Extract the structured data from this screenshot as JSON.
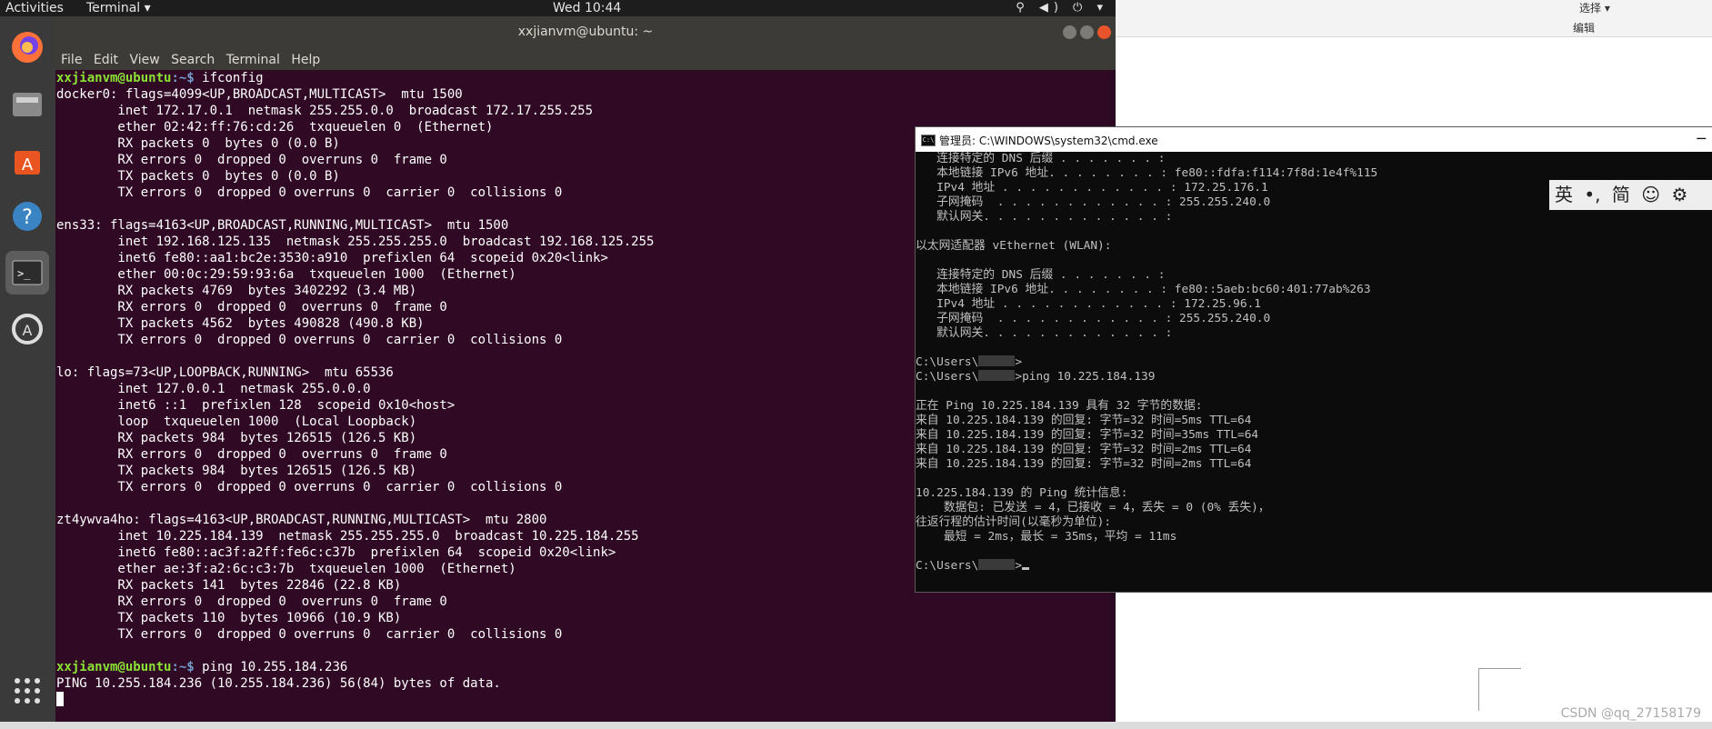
{
  "topbar": {
    "activities": "Activities",
    "app_menu": "Terminal ▾",
    "clock": "Wed 10:44",
    "tray": "⚲ ◀) ⏻ ▾"
  },
  "dock": {
    "items": [
      "firefox",
      "files",
      "software",
      "help",
      "terminal",
      "update"
    ],
    "grid": "⋮⋮⋮"
  },
  "terminal": {
    "title": "xxjianvm@ubuntu: ~",
    "menu": [
      "File",
      "Edit",
      "View",
      "Search",
      "Terminal",
      "Help"
    ],
    "prompt_user": "xxjianvm@ubuntu",
    "prompt_path": ":~$ ",
    "cmd1": "ifconfig",
    "output": "docker0: flags=4099<UP,BROADCAST,MULTICAST>  mtu 1500\n        inet 172.17.0.1  netmask 255.255.0.0  broadcast 172.17.255.255\n        ether 02:42:ff:76:cd:26  txqueuelen 0  (Ethernet)\n        RX packets 0  bytes 0 (0.0 B)\n        RX errors 0  dropped 0  overruns 0  frame 0\n        TX packets 0  bytes 0 (0.0 B)\n        TX errors 0  dropped 0 overruns 0  carrier 0  collisions 0\n\nens33: flags=4163<UP,BROADCAST,RUNNING,MULTICAST>  mtu 1500\n        inet 192.168.125.135  netmask 255.255.255.0  broadcast 192.168.125.255\n        inet6 fe80::aa1:bc2e:3530:a910  prefixlen 64  scopeid 0x20<link>\n        ether 00:0c:29:59:93:6a  txqueuelen 1000  (Ethernet)\n        RX packets 4769  bytes 3402292 (3.4 MB)\n        RX errors 0  dropped 0  overruns 0  frame 0\n        TX packets 4562  bytes 490828 (490.8 KB)\n        TX errors 0  dropped 0 overruns 0  carrier 0  collisions 0\n\nlo: flags=73<UP,LOOPBACK,RUNNING>  mtu 65536\n        inet 127.0.0.1  netmask 255.0.0.0\n        inet6 ::1  prefixlen 128  scopeid 0x10<host>\n        loop  txqueuelen 1000  (Local Loopback)\n        RX packets 984  bytes 126515 (126.5 KB)\n        RX errors 0  dropped 0  overruns 0  frame 0\n        TX packets 984  bytes 126515 (126.5 KB)\n        TX errors 0  dropped 0 overruns 0  carrier 0  collisions 0\n\nzt4ywva4ho: flags=4163<UP,BROADCAST,RUNNING,MULTICAST>  mtu 2800\n        inet 10.225.184.139  netmask 255.255.255.0  broadcast 10.225.184.255\n        inet6 fe80::ac3f:a2ff:fe6c:c37b  prefixlen 64  scopeid 0x20<link>\n        ether ae:3f:a2:6c:c3:7b  txqueuelen 1000  (Ethernet)\n        RX packets 141  bytes 22846 (22.8 KB)\n        RX errors 0  dropped 0  overruns 0  frame 0\n        TX packets 110  bytes 10966 (10.9 KB)\n        TX errors 0  dropped 0 overruns 0  carrier 0  collisions 0\n",
    "cmd2": "ping 10.255.184.236",
    "ping_line": "PING 10.255.184.236 (10.255.184.236) 56(84) bytes of data."
  },
  "cmd": {
    "title": "管理员: C:\\WINDOWS\\system32\\cmd.exe",
    "min_icon": "─",
    "block1": "   连接特定的 DNS 后缀 . . . . . . . :\n   本地链接 IPv6 地址. . . . . . . . : fe80::fdfa:f114:7f8d:1e4f%115\n   IPv4 地址 . . . . . . . . . . . . : 172.25.176.1\n   子网掩码  . . . . . . . . . . . . : 255.255.240.0\n   默认网关. . . . . . . . . . . . . :\n\n以太网适配器 vEthernet (WLAN):\n\n   连接特定的 DNS 后缀 . . . . . . . :\n   本地链接 IPv6 地址. . . . . . . . : fe80::5aeb:bc60:401:77ab%263\n   IPv4 地址 . . . . . . . . . . . . : 172.25.96.1\n   子网掩码  . . . . . . . . . . . . : 255.255.240.0\n   默认网关. . . . . . . . . . . . . :\n",
    "user_prefix": "C:\\Users\\",
    "prompt_end": ">",
    "ping_cmd": "ping 10.225.184.139",
    "block2": "\n正在 Ping 10.225.184.139 具有 32 字节的数据:\n来自 10.225.184.139 的回复: 字节=32 时间=5ms TTL=64\n来自 10.225.184.139 的回复: 字节=32 时间=35ms TTL=64\n来自 10.225.184.139 的回复: 字节=32 时间=2ms TTL=64\n来自 10.225.184.139 的回复: 字节=32 时间=2ms TTL=64\n\n10.225.184.139 的 Ping 统计信息:\n    数据包: 已发送 = 4，已接收 = 4，丢失 = 0 (0% 丢失)，\n往返行程的估计时间(以毫秒为单位):\n    最短 = 2ms，最长 = 35ms，平均 = 11ms\n\n"
  },
  "ime": {
    "items": [
      "英",
      "•,",
      "简",
      "☺",
      "⚙"
    ]
  },
  "host": {
    "select": "选择 ▾",
    "edit": "编辑",
    "watermark": "CSDN @qq_27158179"
  }
}
